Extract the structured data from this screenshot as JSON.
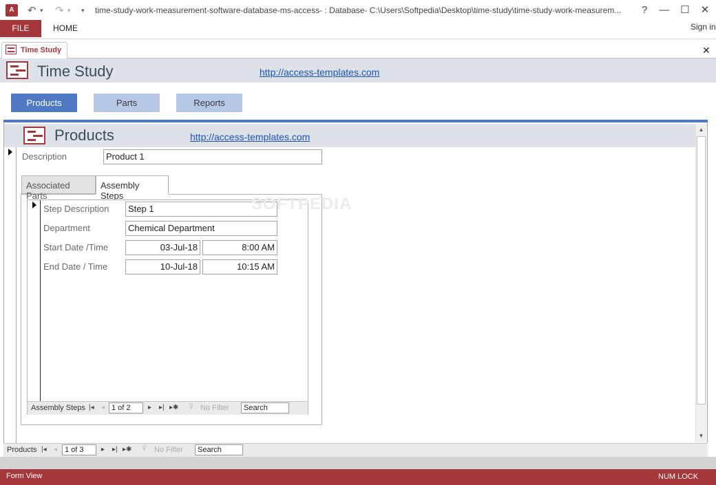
{
  "window": {
    "title": "time-study-work-measurement-software-database-ms-access- : Database- C:\\Users\\Softpedia\\Desktop\\time-study\\time-study-work-measurem...",
    "help_label": "?",
    "minimize_label": "—",
    "maximize_label": "☐",
    "close_label": "✕"
  },
  "ribbon": {
    "file_label": "FILE",
    "home_label": "HOME",
    "signin_label": "Sign in"
  },
  "document_tab": {
    "label": "Time Study",
    "close_label": "✕"
  },
  "main_form": {
    "title": "Time Study",
    "link": "http://access-templates.com",
    "nav_buttons": [
      "Products",
      "Parts",
      "Reports"
    ],
    "active_nav": "Products"
  },
  "products_form": {
    "title": "Products",
    "link": "http://access-templates.com",
    "description_label": "Description",
    "description_value": "Product 1",
    "tabs": [
      "Associated Parts",
      "Assembly Steps"
    ],
    "active_tab": "Assembly Steps"
  },
  "assembly_steps": {
    "step_description_label": "Step Description",
    "step_description_value": "Step 1",
    "department_label": "Department",
    "department_value": "Chemical Department",
    "start_label": "Start Date /Time",
    "start_date": "03-Jul-18",
    "start_time": "8:00 AM",
    "end_label": "End Date / Time",
    "end_date": "10-Jul-18",
    "end_time": "10:15 AM"
  },
  "steps_navbar": {
    "label": "Assembly Steps",
    "record": "1 of 2",
    "filter_label": "No Filter",
    "search_label": "Search"
  },
  "products_navbar": {
    "label": "Products",
    "record": "1 of 3",
    "filter_label": "No Filter",
    "search_label": "Search"
  },
  "statusbar": {
    "left": "Form View",
    "right": "NUM LOCK"
  },
  "watermark": "SOFTPEDIA",
  "colors": {
    "accent": "#a4373a",
    "nav_active": "#4f79c3",
    "nav_inactive": "#b6c8e6",
    "header_band": "#dde1e8",
    "link": "#1a52b8"
  },
  "icons": [
    "access-app-icon",
    "undo-icon",
    "redo-icon",
    "customize-qat-icon",
    "form-icon",
    "record-selector-arrow-icon",
    "first-record-icon",
    "previous-record-icon",
    "next-record-icon",
    "last-record-icon",
    "new-record-icon",
    "filter-icon",
    "scroll-up-icon",
    "scroll-down-icon"
  ]
}
